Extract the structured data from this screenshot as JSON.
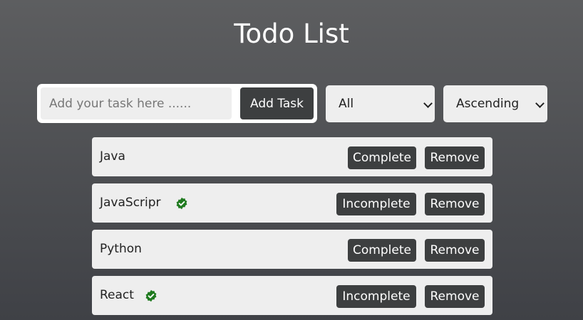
{
  "header": {
    "title": "Todo List"
  },
  "add_form": {
    "placeholder": "Add your task here ......",
    "value": "",
    "button_label": "Add Task"
  },
  "filter": {
    "selected": "All"
  },
  "sort": {
    "selected": "Ascending"
  },
  "todos": [
    {
      "text": "Java",
      "completed": false,
      "toggle_label": "Complete",
      "remove_label": "Remove"
    },
    {
      "text": "JavaScripr",
      "completed": true,
      "toggle_label": "Incomplete",
      "remove_label": "Remove"
    },
    {
      "text": "Python",
      "completed": false,
      "toggle_label": "Complete",
      "remove_label": "Remove"
    },
    {
      "text": "React",
      "completed": true,
      "toggle_label": "Incomplete",
      "remove_label": "Remove"
    }
  ],
  "colors": {
    "button_bg": "#3d3f40",
    "item_bg": "#eeeeee",
    "check_icon": "#1f7a1f"
  },
  "icons": {
    "completed": "check-badge-icon",
    "dropdown": "chevron-down-icon"
  }
}
